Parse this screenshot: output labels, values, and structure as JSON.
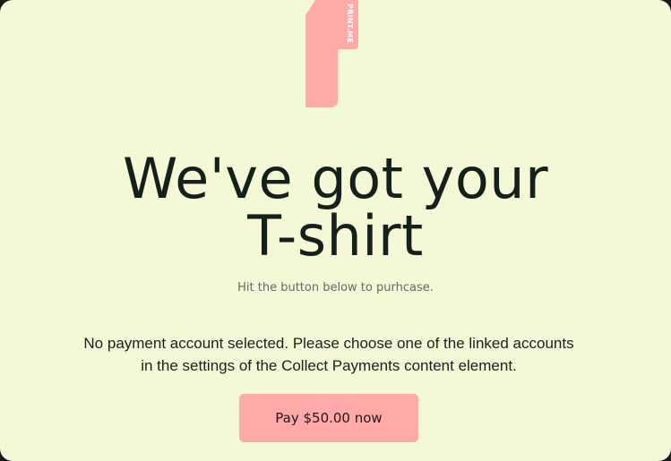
{
  "brand": {
    "logo_text": "PRINT.ME",
    "logo_color": "#ffa9a8"
  },
  "hero": {
    "title_line_1": "We've got your",
    "title_line_2": "T-shirt",
    "subtitle": "Hit the button below to purhcase."
  },
  "payment": {
    "notice": "No payment account selected. Please choose one of the linked accounts in the settings of the Collect Payments content element.",
    "button_label": "Pay $50.00 now",
    "button_color": "#ffa9a8"
  },
  "theme": {
    "background": "#f4f8d6",
    "text": "#142019",
    "muted_text": "#666a63"
  }
}
